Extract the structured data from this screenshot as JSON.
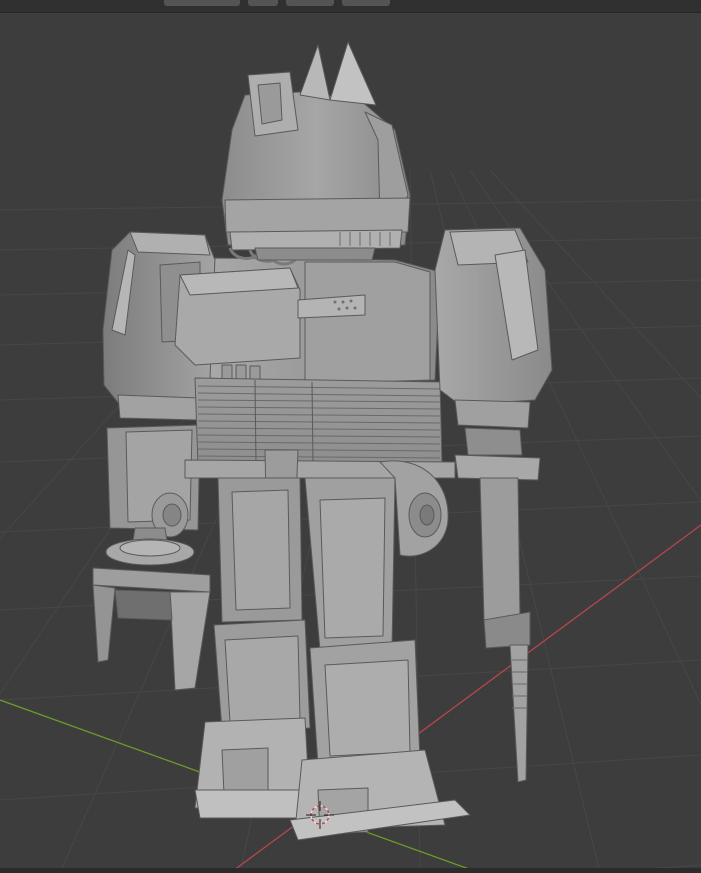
{
  "app": {
    "viewport": {
      "shading_mode": "solid",
      "background_color": "#3d3d3d",
      "grid_color": "#474747",
      "x_axis_color": "#b5474d",
      "y_axis_color": "#6b9a2c",
      "model_color": "#9a9a9a",
      "cursor_icon": "3d-cursor-icon"
    },
    "header": {
      "buttons": [
        {
          "label": "",
          "icon": "object-mode-icon"
        },
        {
          "label": "",
          "icon": "orientation-icon"
        },
        {
          "label": "",
          "icon": "pivot-icon"
        },
        {
          "label": "",
          "icon": "snap-icon"
        }
      ]
    }
  }
}
